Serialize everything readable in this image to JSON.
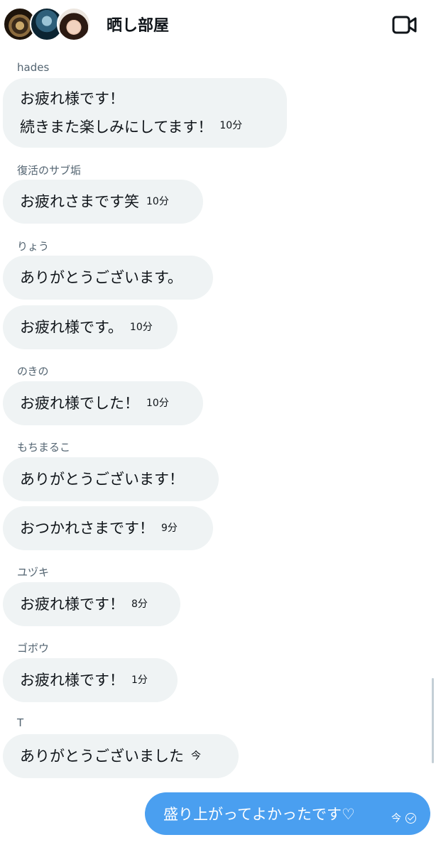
{
  "header": {
    "title": "晒し部屋",
    "video_icon": "video-camera-icon"
  },
  "messages": [
    {
      "sender": "hades",
      "bubbles": [
        {
          "text": "お疲れ様です！\n続きまた楽しみにしてます！",
          "time": "10分"
        }
      ]
    },
    {
      "sender": "復活のサブ垢",
      "bubbles": [
        {
          "text": "お疲れさまです笑",
          "time": "10分"
        }
      ]
    },
    {
      "sender": "りょう",
      "bubbles": [
        {
          "text": "ありがとうございます。",
          "time": ""
        },
        {
          "text": "お疲れ様です。",
          "time": "10分"
        }
      ]
    },
    {
      "sender": "のきの",
      "bubbles": [
        {
          "text": "お疲れ様でした！",
          "time": "10分"
        }
      ]
    },
    {
      "sender": "もちまるこ",
      "bubbles": [
        {
          "text": "ありがとうございます！",
          "time": ""
        },
        {
          "text": "おつかれさまです！",
          "time": "9分"
        }
      ]
    },
    {
      "sender": "ユヅキ",
      "bubbles": [
        {
          "text": "お疲れ様です！",
          "time": "8分"
        }
      ]
    },
    {
      "sender": "ゴボウ",
      "bubbles": [
        {
          "text": "お疲れ様です！",
          "time": "1分"
        }
      ]
    },
    {
      "sender": "T",
      "bubbles": [
        {
          "text": "ありがとうございました",
          "time": "今"
        }
      ]
    }
  ],
  "my_message": {
    "text": "盛り上がってよかったです♡",
    "time": "今"
  },
  "colors": {
    "my_bubble": "#4a9ff0",
    "their_bubble": "#eff3f4",
    "meta_text": "#536471"
  }
}
